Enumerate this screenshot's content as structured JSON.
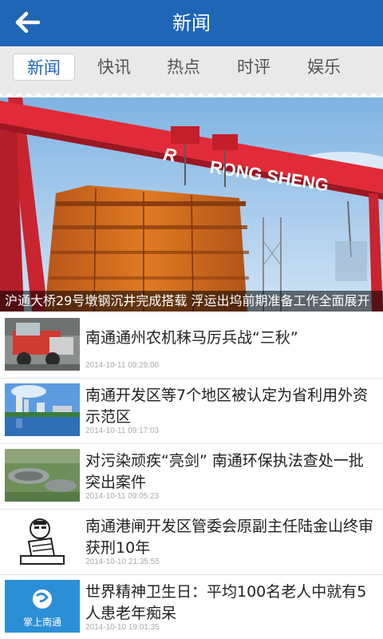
{
  "header": {
    "title": "新闻",
    "back_icon": "back-arrow-icon"
  },
  "tabs": [
    {
      "label": "新闻",
      "active": true
    },
    {
      "label": "快讯",
      "active": false
    },
    {
      "label": "热点",
      "active": false
    },
    {
      "label": "时评",
      "active": false
    },
    {
      "label": "娱乐",
      "active": false
    }
  ],
  "hero": {
    "caption": "沪通大桥29号墩钢沉井完成搭载 浮运出坞前期准备工作全面展开",
    "crane_text": "RONG SHENG"
  },
  "news": [
    {
      "title": "南通通州农机秣马厉兵战“三秋”",
      "date": "2014-10-11 09:29:00"
    },
    {
      "title": "南通开发区等7个地区被认定为省利用外资示范区",
      "date": "2014-10-11 09:17:03"
    },
    {
      "title": "对污染顽疾“亮剑” 南通环保执法查处一批突出案件",
      "date": "2014-10-11 09:05:23"
    },
    {
      "title": "南通港闸开发区管委会原副主任陆金山终审获刑10年",
      "date": "2014-10-10 21:35:55"
    },
    {
      "title": "世界精神卫生日：平均100名老人中就有5人患老年痴呆",
      "date": "2014-10-10 19:01:35",
      "thumb_text": "掌上南通"
    }
  ],
  "colors": {
    "primary": "#1f66b6",
    "tab_bg": "#e9e9e9",
    "crane_red": "#d8283a",
    "caisson_orange": "#d8701e"
  }
}
